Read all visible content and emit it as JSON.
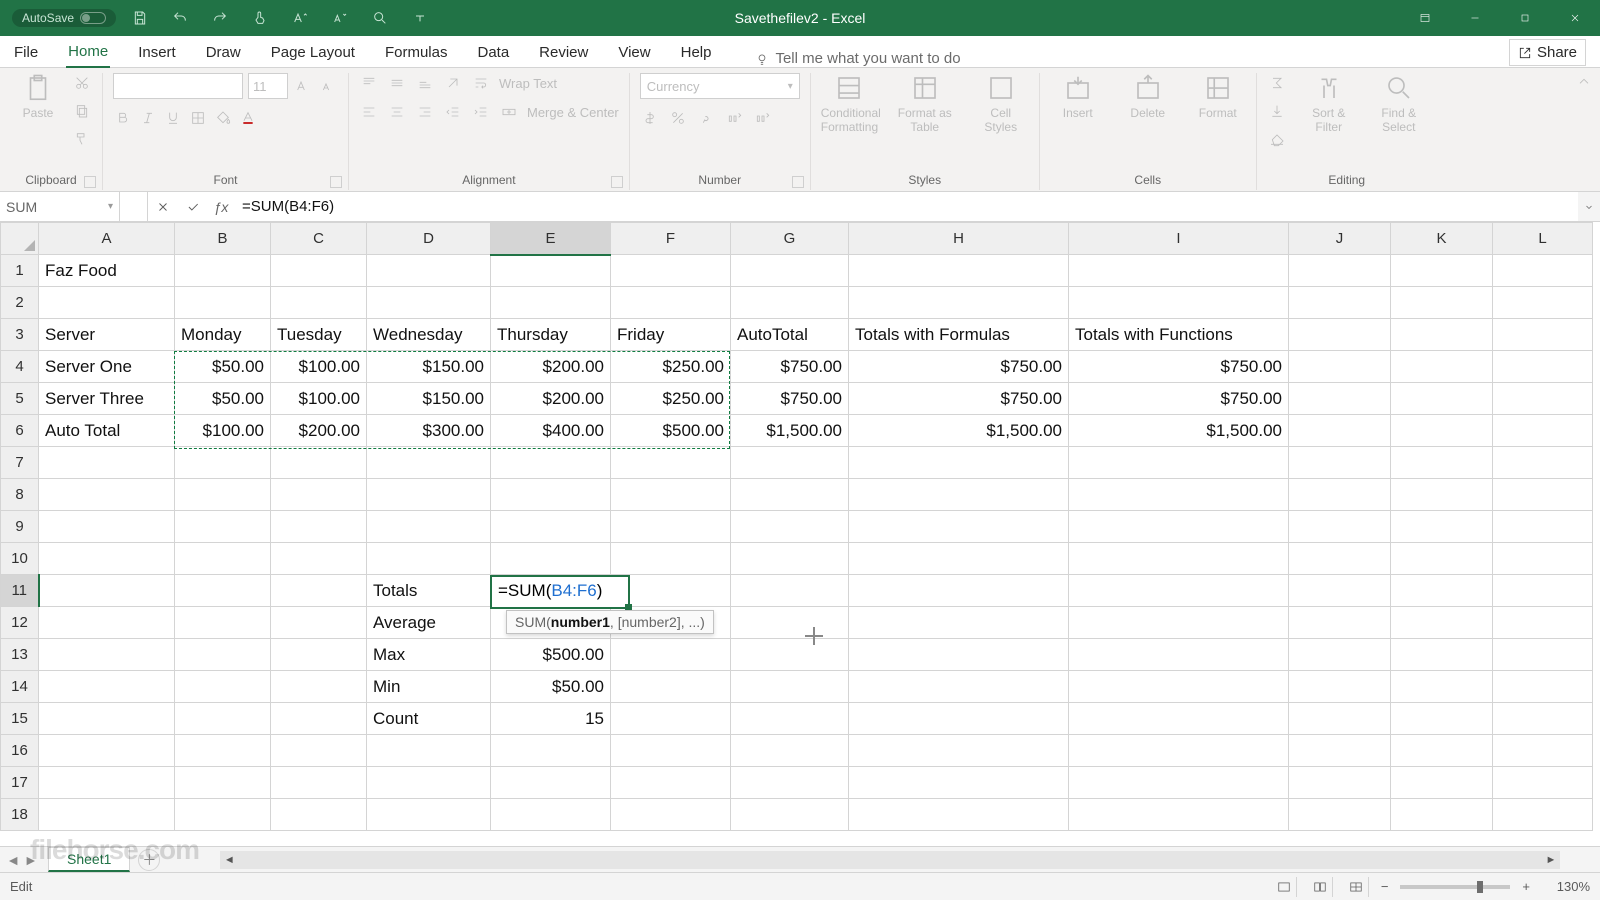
{
  "titlebar": {
    "autosave": "AutoSave",
    "title": "Savethefilev2 - Excel"
  },
  "tabs": [
    "File",
    "Home",
    "Insert",
    "Draw",
    "Page Layout",
    "Formulas",
    "Data",
    "Review",
    "View",
    "Help"
  ],
  "tellme": "Tell me what you want to do",
  "share": "Share",
  "ribbon": {
    "clipboard": {
      "label": "Clipboard",
      "paste": "Paste"
    },
    "font": {
      "label": "Font",
      "size": "11"
    },
    "alignment": {
      "label": "Alignment",
      "wrap": "Wrap Text",
      "merge": "Merge & Center"
    },
    "number": {
      "label": "Number",
      "format": "Currency"
    },
    "styles": {
      "label": "Styles",
      "cond": "Conditional Formatting",
      "fat": "Format as Table",
      "cell": "Cell Styles"
    },
    "cells": {
      "label": "Cells",
      "insert": "Insert",
      "delete": "Delete",
      "format": "Format"
    },
    "editing": {
      "label": "Editing",
      "sort": "Sort & Filter",
      "find": "Find & Select"
    }
  },
  "namebox": "SUM",
  "formula_bar": "=SUM(B4:F6)",
  "active_cell": {
    "prefix": "=SUM(",
    "ref": "B4:F6",
    "suffix": ")"
  },
  "fn_tip": {
    "name": "SUM",
    "arg1": "number1",
    "rest": ", [number2], ...)"
  },
  "columns": [
    "A",
    "B",
    "C",
    "D",
    "E",
    "F",
    "G",
    "H",
    "I",
    "J",
    "K",
    "L"
  ],
  "cells": {
    "A1": "Faz Food",
    "A3": "Server",
    "B3": "Monday",
    "C3": "Tuesday",
    "D3": "Wednesday",
    "E3": "Thursday",
    "F3": "Friday",
    "G3": "AutoTotal",
    "H3": "Totals with Formulas",
    "I3": "Totals with Functions",
    "A4": "Server One",
    "B4": "$50.00",
    "C4": "$100.00",
    "D4": "$150.00",
    "E4": "$200.00",
    "F4": "$250.00",
    "G4": "$750.00",
    "H4": "$750.00",
    "I4": "$750.00",
    "A5": "Server Three",
    "B5": "$50.00",
    "C5": "$100.00",
    "D5": "$150.00",
    "E5": "$200.00",
    "F5": "$250.00",
    "G5": "$750.00",
    "H5": "$750.00",
    "I5": "$750.00",
    "A6": "Auto Total",
    "B6": "$100.00",
    "C6": "$200.00",
    "D6": "$300.00",
    "E6": "$400.00",
    "F6": "$500.00",
    "G6": "$1,500.00",
    "H6": "$1,500.00",
    "I6": "$1,500.00",
    "D11": "Totals",
    "D12": "Average",
    "D13": "Max",
    "E13": "$500.00",
    "D14": "Min",
    "E14": "$50.00",
    "D15": "Count",
    "E15": "15"
  },
  "sheet_tab": "Sheet1",
  "status": "Edit",
  "zoom": "130%",
  "watermark": "filehorse.com"
}
